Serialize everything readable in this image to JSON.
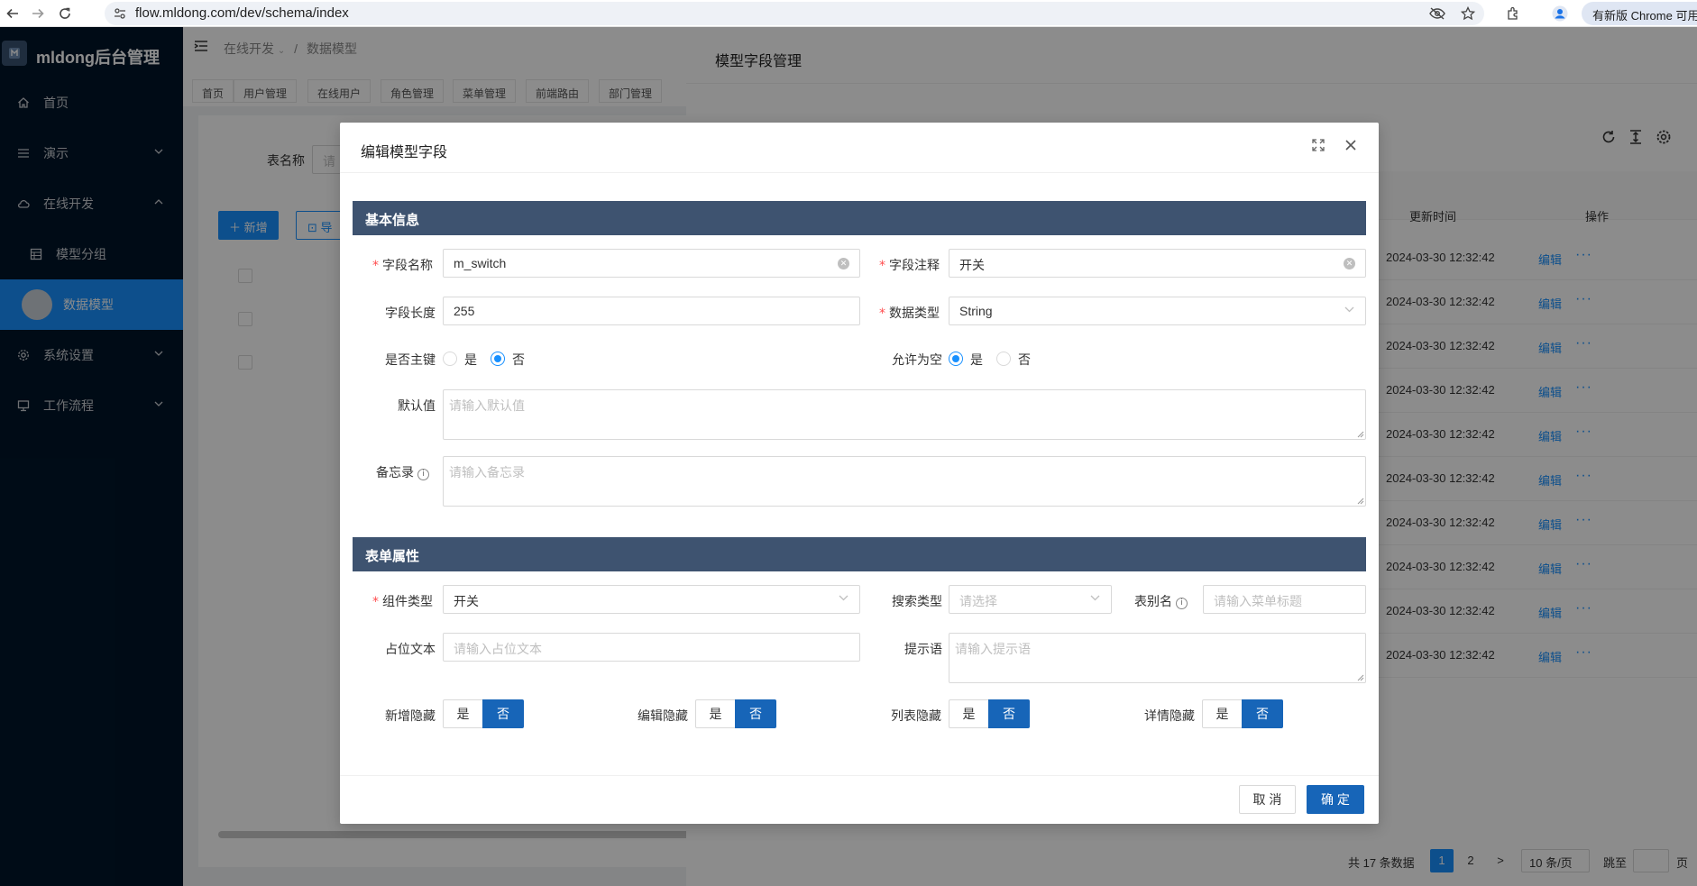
{
  "browser": {
    "url": "flow.mldong.com/dev/schema/index",
    "update_label": "有新版 Chrome 可用"
  },
  "sidebar": {
    "app_title": "mldong后台管理",
    "items": [
      {
        "label": "首页",
        "icon": "home-icon"
      },
      {
        "label": "演示",
        "icon": "menu-icon"
      },
      {
        "label": "在线开发",
        "icon": "cloud-icon"
      },
      {
        "label": "模型分组",
        "icon": "grid-icon"
      },
      {
        "label": "数据模型",
        "icon": "avatar"
      },
      {
        "label": "系统设置",
        "icon": "gear-icon"
      },
      {
        "label": "工作流程",
        "icon": "monitor-icon"
      }
    ]
  },
  "header": {
    "breadcrumb_1": "在线开发",
    "breadcrumb_sep": "/",
    "breadcrumb_2": "数据模型"
  },
  "tabs": [
    "首页",
    "用户管理",
    "在线用户",
    "角色管理",
    "菜单管理",
    "前端路由",
    "部门管理"
  ],
  "page": {
    "search_label": "表名称",
    "search_placeholder": "请",
    "add_button": "新增",
    "import_button": "导"
  },
  "drawer": {
    "title": "模型字段管理",
    "columns": {
      "updated": "更新时间",
      "actions": "操作"
    },
    "rows": [
      {
        "time": "2024-03-30 12:32:42",
        "edit": "编辑",
        "more": "···"
      },
      {
        "time": "2024-03-30 12:32:42",
        "edit": "编辑",
        "more": "···"
      },
      {
        "time": "2024-03-30 12:32:42",
        "edit": "编辑",
        "more": "···"
      },
      {
        "time": "2024-03-30 12:32:42",
        "edit": "编辑",
        "more": "···"
      },
      {
        "time": "2024-03-30 12:32:42",
        "edit": "编辑",
        "more": "···"
      },
      {
        "time": "2024-03-30 12:32:42",
        "edit": "编辑",
        "more": "···"
      },
      {
        "time": "2024-03-30 12:32:42",
        "edit": "编辑",
        "more": "···"
      },
      {
        "time": "2024-03-30 12:32:42",
        "edit": "编辑",
        "more": "···"
      },
      {
        "time": "2024-03-30 12:32:42",
        "edit": "编辑",
        "more": "···"
      },
      {
        "time": "2024-03-30 12:32:42",
        "edit": "编辑",
        "more": "···"
      }
    ],
    "pagination": {
      "total": "共 17 条数据",
      "page1": "1",
      "page2": "2",
      "next": ">",
      "page_size": "10 条/页",
      "jump_label": "跳至",
      "page_suffix": "页"
    }
  },
  "modal": {
    "title": "编辑模型字段",
    "section_basic": "基本信息",
    "section_form": "表单属性",
    "field_name": {
      "label": "字段名称",
      "value": "m_switch"
    },
    "field_comment": {
      "label": "字段注释",
      "value": "开关"
    },
    "field_length": {
      "label": "字段长度",
      "value": "255"
    },
    "data_type": {
      "label": "数据类型",
      "value": "String"
    },
    "is_pk": {
      "label": "是否主键",
      "options": [
        "是",
        "否"
      ],
      "selected": "否"
    },
    "nullable": {
      "label": "允许为空",
      "options": [
        "是",
        "否"
      ],
      "selected": "是"
    },
    "default_value": {
      "label": "默认值",
      "placeholder": "请输入默认值"
    },
    "memo": {
      "label": "备忘录",
      "placeholder": "请输入备忘录"
    },
    "component_type": {
      "label": "组件类型",
      "value": "开关"
    },
    "search_type": {
      "label": "搜索类型",
      "placeholder": "请选择"
    },
    "form_alias": {
      "label": "表别名",
      "placeholder": "请输入菜单标题"
    },
    "placeholder_text": {
      "label": "占位文本",
      "placeholder": "请输入占位文本"
    },
    "hint": {
      "label": "提示语",
      "placeholder": "请输入提示语"
    },
    "hide_add": {
      "label": "新增隐藏",
      "yes": "是",
      "no": "否",
      "selected": "否"
    },
    "hide_edit": {
      "label": "编辑隐藏",
      "yes": "是",
      "no": "否",
      "selected": "否"
    },
    "hide_list": {
      "label": "列表隐藏",
      "yes": "是",
      "no": "否",
      "selected": "否"
    },
    "hide_detail": {
      "label": "详情隐藏",
      "yes": "是",
      "no": "否",
      "selected": "否"
    },
    "cancel_button": "取 消",
    "ok_button": "确 定"
  },
  "colors": {
    "primary": "#1890ff",
    "modal_primary": "#1765b8",
    "section_head": "#3e5370",
    "sidebar": "#001529"
  }
}
